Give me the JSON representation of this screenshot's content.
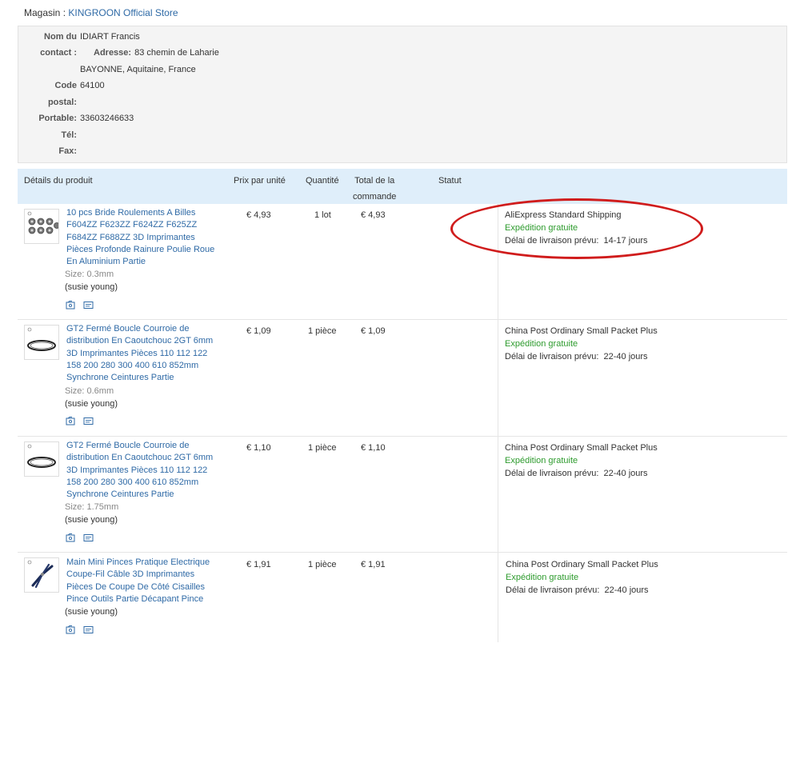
{
  "store": {
    "label": "Magasin :",
    "name": "KINGROON Official Store"
  },
  "contact": {
    "name_label_1": "Nom du",
    "name_label_2": "contact :",
    "name": "IDIART Francis",
    "address_label": "Adresse:",
    "address_line1": "83 chemin de Laharie",
    "address_line2": "BAYONNE, Aquitaine, France",
    "postal_label_1": "Code",
    "postal_label_2": "postal:",
    "postal_code": "64100",
    "mobile_label": "Portable:",
    "mobile": "33603246633",
    "phone_label": "Tél:",
    "phone": "",
    "fax_label": "Fax:",
    "fax": ""
  },
  "table": {
    "headers": {
      "product": "Détails du produit",
      "unit_price": "Prix par unité",
      "quantity": "Quantité",
      "total_line1": "Total de la",
      "total_line2": "commande",
      "status": "Statut"
    },
    "rows": [
      {
        "name_lines": [
          "10 pcs Bride Roulements A Billes",
          "F604ZZ F623ZZ F624ZZ F625ZZ",
          "F684ZZ F688ZZ 3D Imprimantes",
          "Pièces Profonde Rainure Poulie Roue",
          "En Aluminium Partie"
        ],
        "size": "Size: 0.3mm",
        "seller": "(susie young)",
        "price": "€ 4,93",
        "quantity": "1 lot",
        "total": "€ 4,93",
        "shipping_method": "AliExpress Standard Shipping",
        "shipping_cost": "Expédition gratuite",
        "delay_label": "Délai de livraison prévu:",
        "delay": "14-17 jours"
      },
      {
        "name_lines": [
          "GT2 Fermé Boucle Courroie de",
          "distribution En Caoutchouc 2GT 6mm",
          "3D Imprimantes Pièces 110 112 122",
          "158 200 280 300 400 610 852mm",
          "Synchrone Ceintures Partie"
        ],
        "size": "Size: 0.6mm",
        "seller": "(susie young)",
        "price": "€ 1,09",
        "quantity": "1 pièce",
        "total": "€ 1,09",
        "shipping_method": "China Post Ordinary Small Packet Plus",
        "shipping_cost": "Expédition gratuite",
        "delay_label": "Délai de livraison prévu:",
        "delay": "22-40 jours"
      },
      {
        "name_lines": [
          "GT2 Fermé Boucle Courroie de",
          "distribution En Caoutchouc 2GT 6mm",
          "3D Imprimantes Pièces 110 112 122",
          "158 200 280 300 400 610 852mm",
          "Synchrone Ceintures Partie"
        ],
        "size": "Size: 1.75mm",
        "seller": "(susie young)",
        "price": "€ 1,10",
        "quantity": "1 pièce",
        "total": "€ 1,10",
        "shipping_method": "China Post Ordinary Small Packet Plus",
        "shipping_cost": "Expédition gratuite",
        "delay_label": "Délai de livraison prévu:",
        "delay": "22-40 jours"
      },
      {
        "name_lines": [
          "Main Mini Pinces Pratique Electrique",
          "Coupe-Fil Câble 3D Imprimantes",
          "Pièces De Coupe De Côté Cisailles",
          "Pince Outils Partie Décapant Pince"
        ],
        "size": "",
        "seller": "(susie young)",
        "price": "€ 1,91",
        "quantity": "1 pièce",
        "total": "€ 1,91",
        "shipping_method": "China Post Ordinary Small Packet Plus",
        "shipping_cost": "Expédition gratuite",
        "delay_label": "Délai de livraison prévu:",
        "delay": "22-40 jours"
      }
    ]
  },
  "colors": {
    "link": "#2f6aa6",
    "free_shipping": "#2e9b2e",
    "header_bg": "#dfeefa",
    "highlight_circle": "#d01c1c"
  },
  "icons": [
    "bearings-thumbnail",
    "belt-thumbnail",
    "pliers-thumbnail",
    "snapshot-icon",
    "message-icon"
  ]
}
